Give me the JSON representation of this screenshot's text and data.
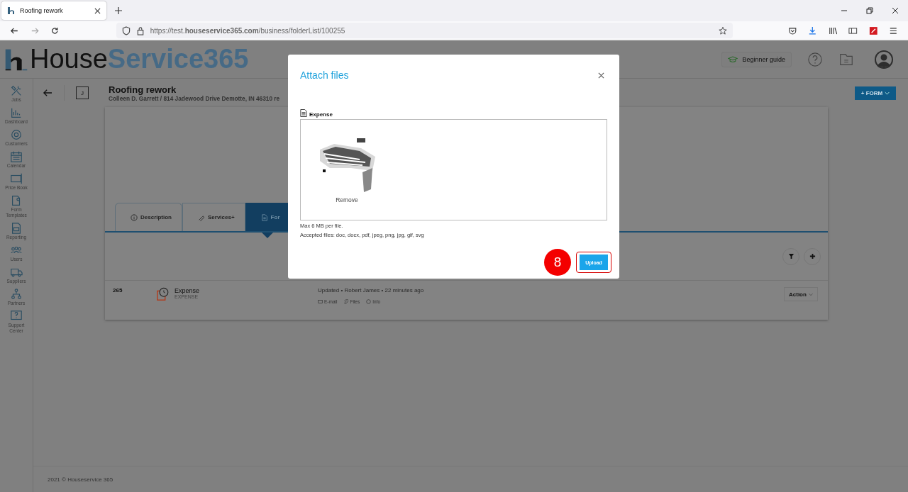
{
  "browser": {
    "tab_title": "Roofing rework",
    "url": "https://test.**houseservice365.com**/business/folderList/100255"
  },
  "logo": {
    "first": "House",
    "second": "Service365"
  },
  "header": {
    "guide_button": "Beginner guide"
  },
  "sidebar": {
    "items": [
      {
        "label": "Jobs"
      },
      {
        "label": "Dashboard"
      },
      {
        "label": "Customers"
      },
      {
        "label": "Calendar"
      },
      {
        "label": "Price Book"
      },
      {
        "label": "Form Templates"
      },
      {
        "label": "Reporting"
      },
      {
        "label": "Users"
      },
      {
        "label": "Suppliers"
      },
      {
        "label": "Partners"
      },
      {
        "label": "Support Center"
      }
    ]
  },
  "job": {
    "badge": "J",
    "title": "Roofing rework",
    "subtitle": "Colleen D. Garrett / 814 Jadewood Drive Demotte, IN 46310 re",
    "form_button": "+ FORM"
  },
  "tabs": [
    {
      "label": "Description",
      "selected": false
    },
    {
      "label": "Services+",
      "selected": false
    },
    {
      "label": "For",
      "selected": true
    }
  ],
  "rows": [
    {
      "number": "265",
      "name": "Expense",
      "type": "EXPENSE",
      "updated": "Updated • Robert James • 22 minutes ago",
      "links": [
        "E-mail",
        "Files",
        "Info"
      ],
      "action": "Action"
    }
  ],
  "footer": "2021 © Houseservice 365",
  "modal": {
    "title": "Attach files",
    "file_label": "Expense",
    "remove": "Remove",
    "max_size": "Max 6 MB per file.",
    "accepted": "Accepted files: doc, docx, pdf, jpeg, png, jpg, gif, svg",
    "upload_button": "Upload",
    "highlighted": true,
    "step_badge": "8"
  }
}
